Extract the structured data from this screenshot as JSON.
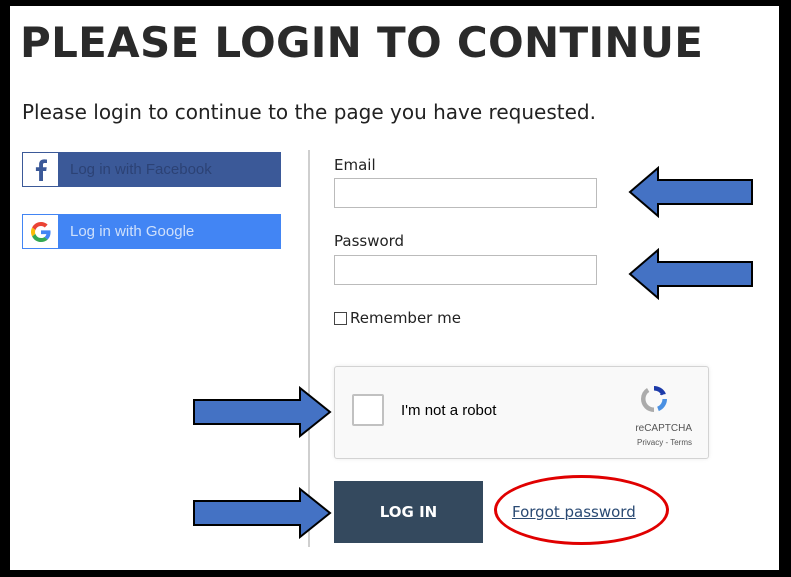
{
  "heading": "PLEASE LOGIN TO CONTINUE",
  "subheading": "Please login to continue to the page you have requested.",
  "social": {
    "facebook": {
      "label": "Log in with Facebook",
      "icon": "facebook-icon",
      "color": "#3b5998"
    },
    "google": {
      "label": "Log in with Google",
      "icon": "google-icon",
      "color": "#4285f4"
    }
  },
  "form": {
    "email_label": "Email",
    "email_value": "",
    "password_label": "Password",
    "password_value": "",
    "remember_label": "Remember me",
    "remember_checked": false
  },
  "recaptcha": {
    "checkbox_label": "I'm not a robot",
    "brand": "reCAPTCHA",
    "links": "Privacy - Terms"
  },
  "actions": {
    "login_label": "LOG IN",
    "forgot_label": "Forgot password"
  },
  "colors": {
    "button_bg": "#34495e",
    "annotation_arrow": "#4472c4",
    "annotation_circle": "#e00000"
  }
}
